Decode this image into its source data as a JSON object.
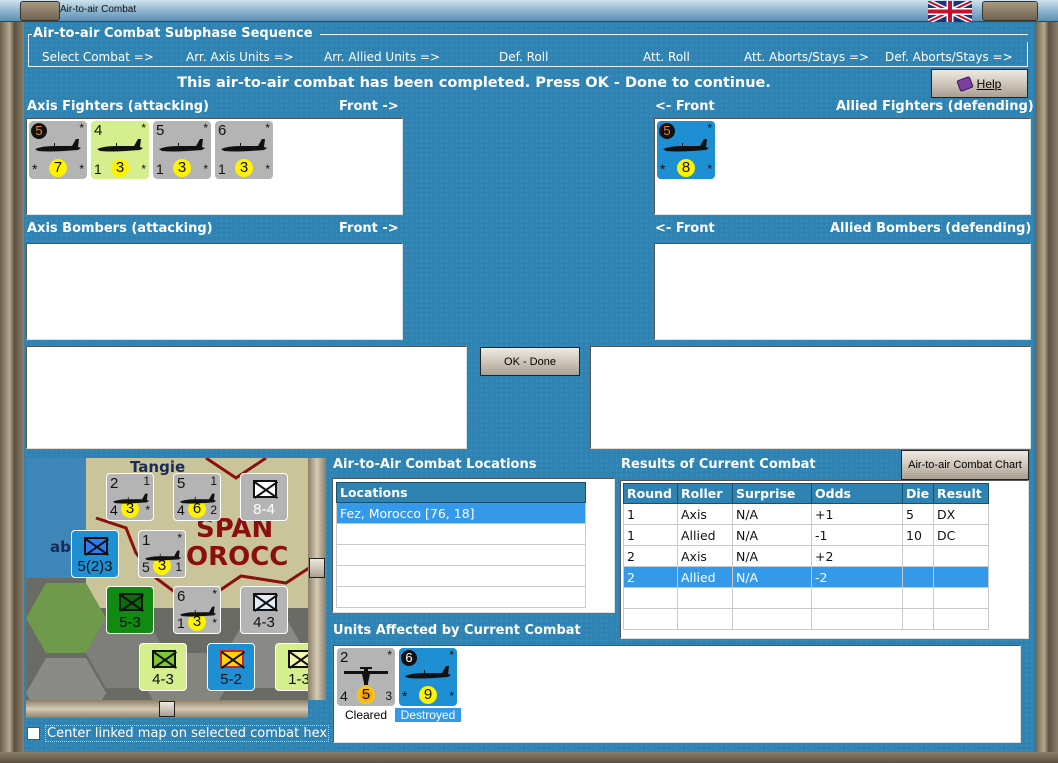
{
  "window": {
    "title": "Air-to-air Combat"
  },
  "sequence": {
    "title": "Air-to-air Combat Subphase Sequence",
    "steps": [
      "Select Combat =>",
      "Arr. Axis Units =>",
      "Arr. Allied Units =>",
      "Def. Roll",
      "Att. Roll",
      "Att. Aborts/Stays =>",
      "Def. Aborts/Stays =>"
    ]
  },
  "message": "This air-to-air combat has been completed.  Press OK - Done to continue.",
  "help_button": "Help",
  "axis_fighters": {
    "label": "Axis Fighters (attacking)",
    "front": "Front ->",
    "units": [
      {
        "tl": "5",
        "tl_style": "dark",
        "tr": "*",
        "bl": "*",
        "mid": "7",
        "br": "*",
        "color": "#b4b4b4"
      },
      {
        "tl": "4",
        "tr": "*",
        "bl": "1",
        "mid": "3",
        "br": "*",
        "color": "#d5ee8e"
      },
      {
        "tl": "5",
        "tr": "*",
        "bl": "1",
        "mid": "3",
        "br": "*",
        "color": "#b4b4b4"
      },
      {
        "tl": "6",
        "tr": "*",
        "bl": "1",
        "mid": "3",
        "br": "*",
        "color": "#b4b4b4"
      }
    ]
  },
  "allied_fighters": {
    "label": "Allied Fighters (defending)",
    "front": "<- Front",
    "units": [
      {
        "tl": "5",
        "tl_style": "dark",
        "tr": "*",
        "bl": "*",
        "mid": "8",
        "br": "*",
        "color": "#1d8fd2"
      }
    ]
  },
  "axis_bombers": {
    "label": "Axis Bombers (attacking)",
    "front": "Front ->"
  },
  "allied_bombers": {
    "label": "Allied Bombers (defending)",
    "front": "<- Front"
  },
  "ok_button": "OK - Done",
  "map": {
    "labels": [
      "Tangie",
      "SPAN",
      "OROCC",
      "ab"
    ],
    "units": [
      "8-4",
      "5(2)3",
      "5-3",
      "4-3",
      "4-3",
      "5-2",
      "1-3"
    ],
    "air_units": [
      {
        "tl": "2",
        "tr": "1",
        "bl": "4",
        "mid": "3",
        "br": "*"
      },
      {
        "tl": "5",
        "tr": "1",
        "bl": "4",
        "mid": "6",
        "br": "2"
      },
      {
        "tl": "1",
        "tr": "*",
        "bl": "5",
        "mid": "3",
        "br": "1"
      },
      {
        "tl": "6",
        "tr": "*",
        "bl": "1",
        "mid": "3",
        "br": "*"
      }
    ],
    "center_checkbox": "Center linked map on selected combat hex",
    "center_checked": false
  },
  "locations": {
    "label": "Air-to-Air Combat Locations",
    "header": "Locations",
    "rows": [
      "Fez, Morocco [76, 18]"
    ]
  },
  "results": {
    "label": "Results of Current Combat",
    "chart_button": "Air-to-air Combat Chart",
    "columns": [
      "Round",
      "Roller",
      "Surprise",
      "Odds",
      "Die",
      "Result"
    ],
    "rows": [
      [
        "1",
        "Axis",
        "N/A",
        "+1",
        "5",
        "DX"
      ],
      [
        "1",
        "Allied",
        "N/A",
        "-1",
        "10",
        "DC"
      ],
      [
        "2",
        "Axis",
        "N/A",
        "+2",
        "",
        ""
      ],
      [
        "2",
        "Allied",
        "N/A",
        "-2",
        "",
        ""
      ]
    ],
    "selected_row": 3
  },
  "affected": {
    "label": "Units Affected by Current Combat",
    "units": [
      {
        "tl": "2",
        "tr": "*",
        "bl": "4",
        "mid": "5",
        "br": "3",
        "color": "#b4b4b4",
        "status": "Cleared",
        "type": "bomber"
      },
      {
        "tl": "6",
        "tl_style": "darkw",
        "tr": "*",
        "bl": "*",
        "mid": "9",
        "br": "*",
        "color": "#1d8fd2",
        "status": "Destroyed",
        "type": "fighter"
      }
    ]
  }
}
